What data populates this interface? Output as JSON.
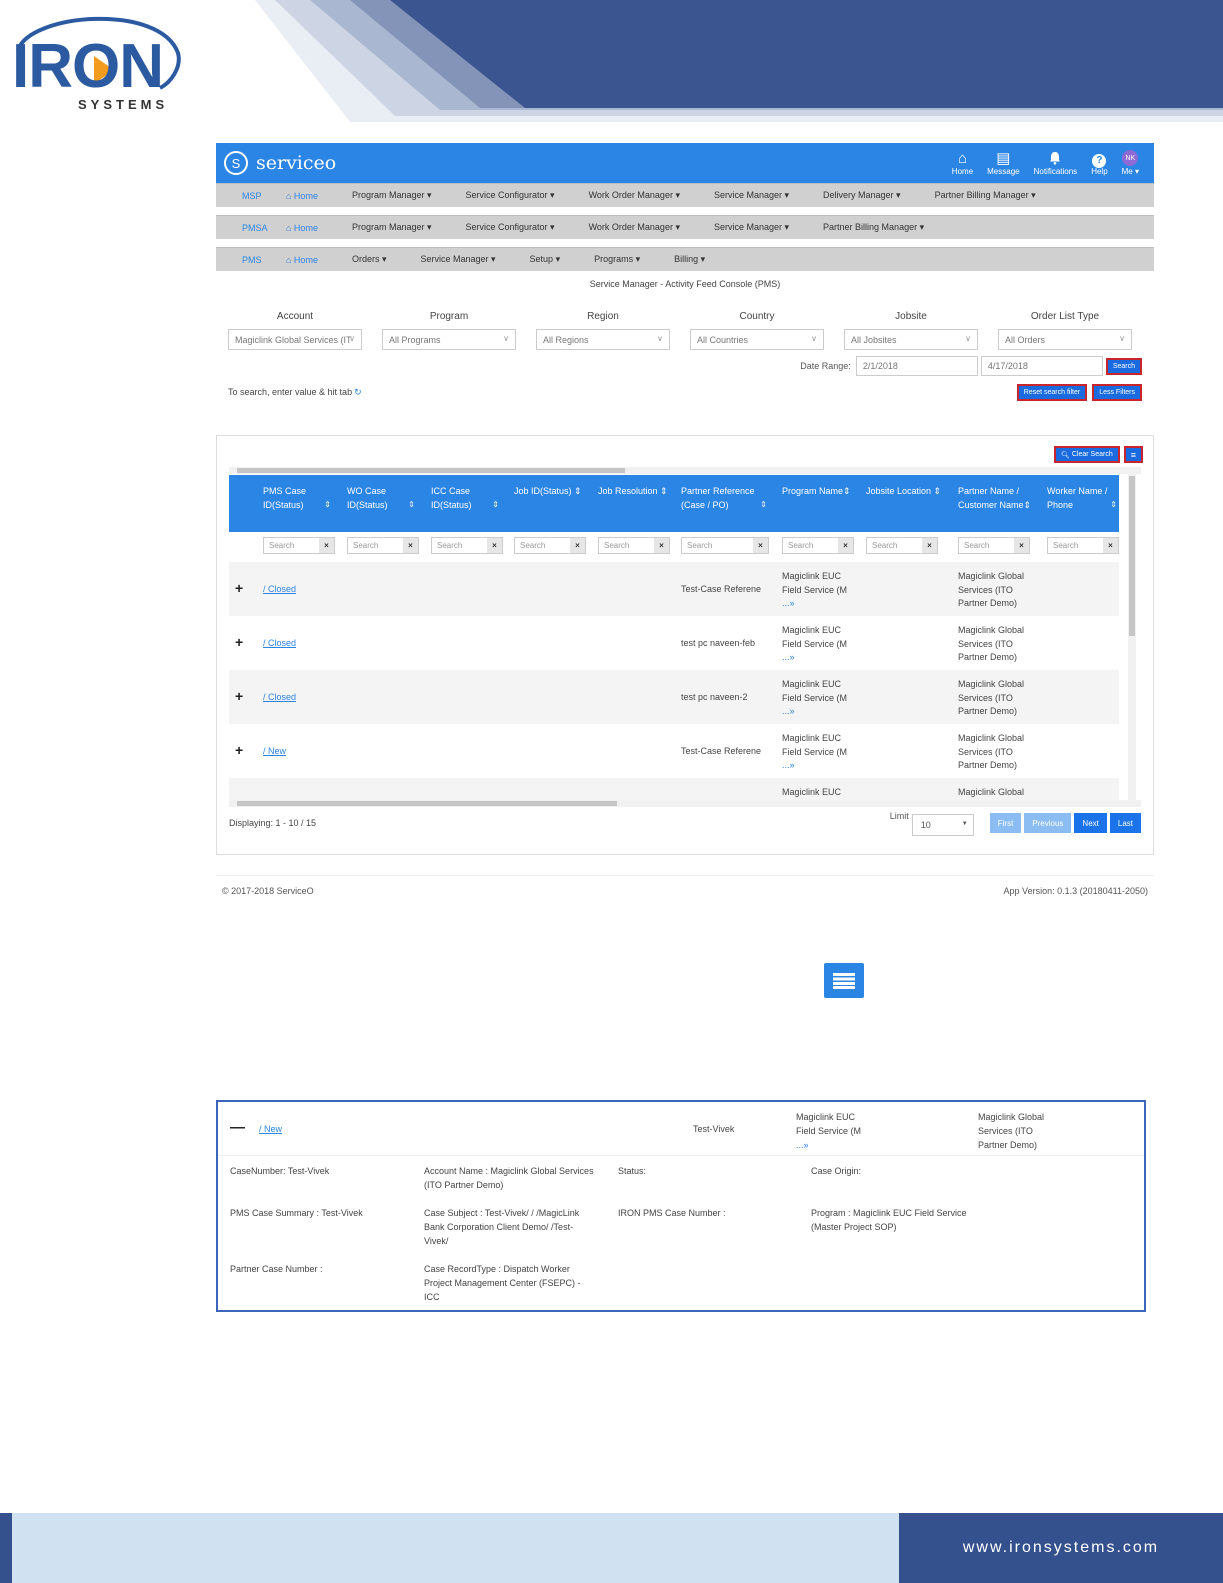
{
  "company": {
    "logo_word": "IRON",
    "logo_sub": "SYSTEMS",
    "website": "www.ironsystems.com"
  },
  "app": {
    "brand": "serviceo",
    "brand_glyph": "S",
    "top_icons": [
      {
        "icon": "home-icon",
        "glyph": "⌂",
        "label": "Home"
      },
      {
        "icon": "message-icon",
        "glyph": "▤",
        "label": "Message"
      },
      {
        "icon": "bell-icon",
        "glyph": "🔔",
        "label": "Notifications"
      },
      {
        "icon": "help-icon",
        "glyph": "?",
        "label": "Help"
      }
    ],
    "user": {
      "initials": "NK",
      "label": "Me ▾"
    },
    "navs": [
      {
        "role": "MSP",
        "home": "⌂ Home",
        "items": [
          "Program Manager ▾",
          "Service Configurator ▾",
          "Work Order Manager ▾",
          "Service Manager ▾",
          "Delivery Manager ▾",
          "Partner Billing Manager ▾"
        ]
      },
      {
        "role": "PMSA",
        "home": "⌂ Home",
        "items": [
          "Program Manager ▾",
          "Service Configurator ▾",
          "Work Order Manager ▾",
          "Service Manager ▾",
          "Partner Billing Manager ▾"
        ]
      },
      {
        "role": "PMS",
        "home": "⌂ Home",
        "items": [
          "Orders ▾",
          "Service Manager ▾",
          "Setup ▾",
          "Programs ▾",
          "Billing ▾"
        ]
      }
    ],
    "console_title": "Service Manager - Activity Feed Console (PMS)",
    "filters": [
      {
        "label": "Account",
        "value": "Magiclink Global Services (IT"
      },
      {
        "label": "Program",
        "value": "All Programs"
      },
      {
        "label": "Region",
        "value": "All Regions"
      },
      {
        "label": "Country",
        "value": "All Countries"
      },
      {
        "label": "Jobsite",
        "value": "All Jobsites"
      },
      {
        "label": "Order List Type",
        "value": "All Orders"
      }
    ],
    "date_range": {
      "label": "Date Range:",
      "from": "2/1/2018",
      "to": "4/17/2018",
      "search_button": "Search"
    },
    "hint": "To search, enter value & hit tab",
    "reset_button": "Reset search filter",
    "less_filters_button": "Less Filters",
    "clear_search_button": "Clear Search",
    "grid": {
      "columns": [
        {
          "l1": "PMS Case",
          "l2": "ID(Status)",
          "sort": "⇕"
        },
        {
          "l1": "WO Case",
          "l2": "ID(Status)",
          "sort": "⇕"
        },
        {
          "l1": "ICC Case",
          "l2": "ID(Status)",
          "sort": "⇕"
        },
        {
          "l1": "Job ID(Status) ⇕",
          "l2": "",
          "sort": ""
        },
        {
          "l1": "Job Resolution ⇕",
          "l2": "",
          "sort": ""
        },
        {
          "l1": "Partner Reference",
          "l2": "(Case / PO)",
          "sort": "⇕"
        },
        {
          "l1": "Program Name⇕",
          "l2": "",
          "sort": ""
        },
        {
          "l1": "Jobsite Location ⇕",
          "l2": "",
          "sort": ""
        },
        {
          "l1": "Partner Name /",
          "l2": "Customer Name⇕",
          "sort": ""
        },
        {
          "l1": "Worker Name /",
          "l2": "Phone",
          "sort": "⇕"
        }
      ],
      "search_placeholder": "Search",
      "rows": [
        {
          "case": "/ Closed",
          "ref": "Test-Case Referene",
          "prog1": "Magiclink EUC",
          "prog2": "Field Service (M",
          "more": "...»",
          "part1": "Magiclink Global",
          "part2": "Services (ITO",
          "part3": "Partner Demo)"
        },
        {
          "case": "/ Closed",
          "ref": "test pc naveen-feb",
          "prog1": "Magiclink EUC",
          "prog2": "Field Service (M",
          "more": "...»",
          "part1": "Magiclink Global",
          "part2": "Services (ITO",
          "part3": "Partner Demo)"
        },
        {
          "case": "/ Closed",
          "ref": "test pc naveen-2",
          "prog1": "Magiclink EUC",
          "prog2": "Field Service (M",
          "more": "...»",
          "part1": "Magiclink Global",
          "part2": "Services (ITO",
          "part3": "Partner Demo)"
        },
        {
          "case": "/ New",
          "ref": "Test-Case Referene",
          "prog1": "Magiclink EUC",
          "prog2": "Field Service (M",
          "more": "...»",
          "part1": "Magiclink Global",
          "part2": "Services (ITO",
          "part3": "Partner Demo)"
        },
        {
          "case": "",
          "ref": "",
          "prog1": "Magiclink EUC",
          "prog2": "",
          "more": "",
          "part1": "Magiclink Global",
          "part2": "",
          "part3": ""
        }
      ],
      "displaying": "Displaying: 1 - 10 / 15",
      "limit_label": "Limit",
      "limit_value": "10",
      "pager": [
        "First",
        "Previous",
        "Next",
        "Last"
      ]
    },
    "footer_left": "© 2017-2018 ServiceO",
    "footer_right": "App Version: 0.1.3 (20180411-2050)"
  },
  "expanded": {
    "case": "/ New",
    "ref": "Test-Vivek",
    "prog1": "Magiclink EUC",
    "prog2": "Field Service (M",
    "more": "...»",
    "part1": "Magiclink Global",
    "part2": "Services (ITO",
    "part3": "Partner Demo)",
    "case_number": "CaseNumber: Test-Vivek",
    "account_name_1": "Account Name : Magiclink Global Services",
    "account_name_2": "(ITO Partner Demo)",
    "status": "Status:",
    "case_origin": "Case Origin:",
    "summary": "PMS Case Summary : Test-Vivek",
    "subject_1": "Case Subject : Test-Vivek/ / /MagicLink",
    "subject_2": "Bank Corporation Client Demo/ /Test-",
    "subject_3": "Vivek/",
    "iron_number": "IRON PMS Case Number :",
    "program_1": "Program : Magiclink EUC Field Service",
    "program_2": "(Master Project SOP)",
    "partner_case": "Partner Case Number :",
    "record_1": "Case RecordType : Dispatch Worker",
    "record_2": "Project Management Center (FSEPC) -",
    "record_3": "ICC"
  }
}
